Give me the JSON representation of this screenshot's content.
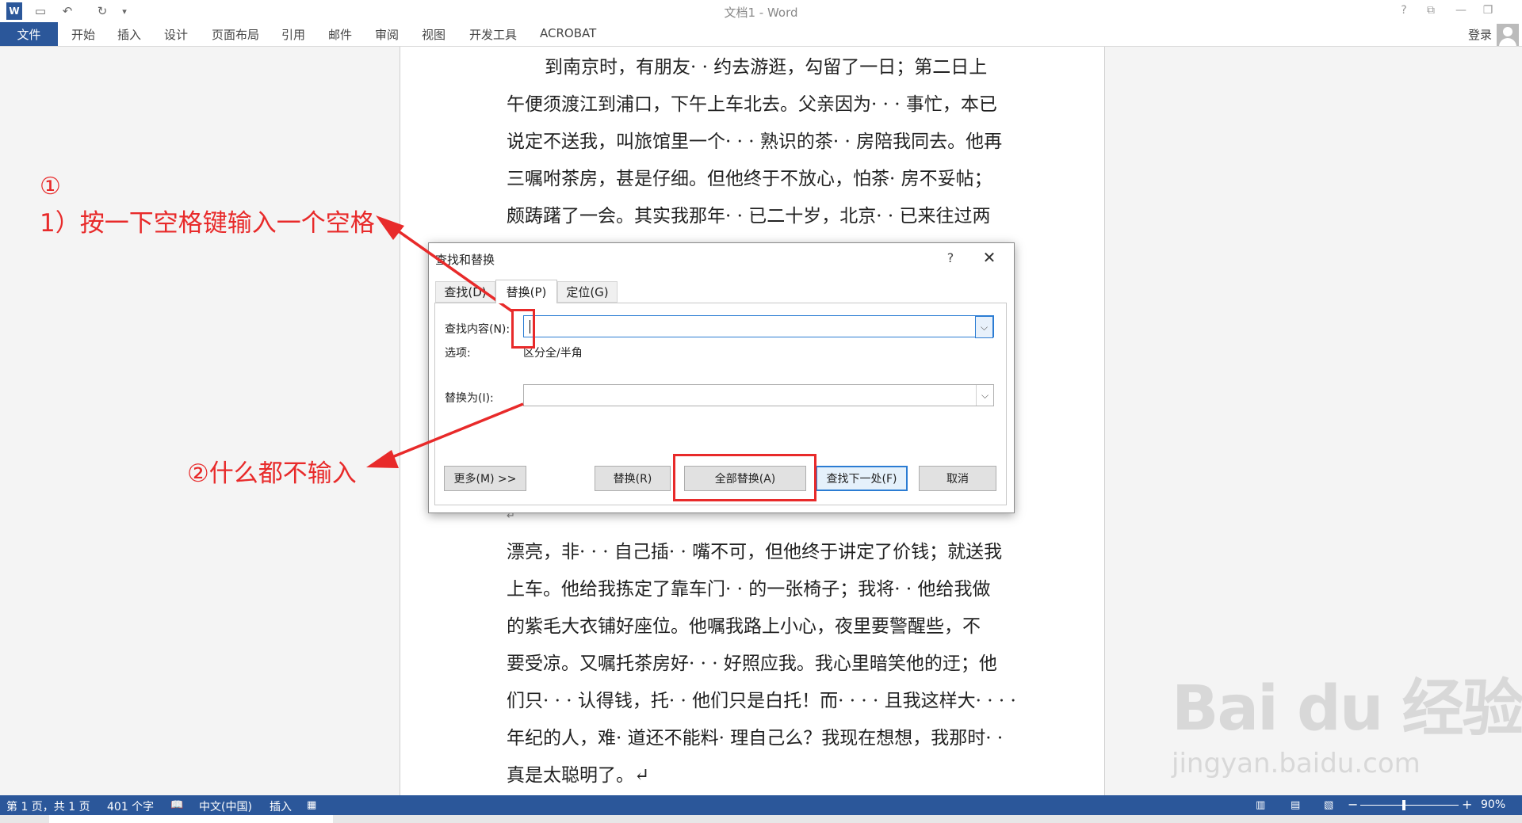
{
  "window": {
    "title": "文档1 - Word",
    "buttons": {
      "help": "?",
      "ribbon_display": "⧉",
      "minimize": "—",
      "restore": "❐"
    }
  },
  "quick_access": {
    "app_icon": "W",
    "save": "▭",
    "undo": "↶",
    "redo": "↻",
    "customize": "▾"
  },
  "ribbon": {
    "file_tab": "文件",
    "tabs": [
      "开始",
      "插入",
      "设计",
      "页面布局",
      "引用",
      "邮件",
      "审阅",
      "视图",
      "开发工具",
      "ACROBAT"
    ],
    "signin": "登录",
    "active_color": "#2b579a"
  },
  "document": {
    "lines_top": [
      "到南京时，有朋友· · 约去游逛，勾留了一日；第二日上",
      "午便须渡江到浦口，下午上车北去。父亲因为· · · 事忙，本已",
      "说定不送我，叫旅馆里一个· · · 熟识的茶· · 房陪我同去。他再",
      "三嘱咐茶房，甚是仔细。但他终于不放心，怕茶· 房不妥帖；",
      "颇踌躇了一会。其实我那年· · 已二十岁，北京· · 已来往过两"
    ],
    "paragraph_mark": "↵",
    "lines_bottom": [
      "漂亮，非· · · 自己插· · 嘴不可，但他终于讲定了价钱；就送我",
      "上车。他给我拣定了靠车门· · 的一张椅子；我将· · 他给我做",
      "的紫毛大衣铺好座位。他嘱我路上小心，夜里要警醒些，不",
      "要受凉。又嘱托茶房好· · · 好照应我。我心里暗笑他的迂；他",
      "们只· · · 认得钱，托· · 他们只是白托！而· · · · 且我这样大· · · ·",
      "年纪的人，难· 道还不能料· 理自己么？我现在想想，我那时· ·",
      "真是太聪明了。↵"
    ]
  },
  "annotations": {
    "step1_marker": "①",
    "step1_text": "1）按一下空格键输入一个空格",
    "step2_text": "②什么都不输入",
    "color": "#e82a2a"
  },
  "dialog": {
    "title": "查找和替换",
    "help": "?",
    "close": "✕",
    "tabs": [
      "查找(D)",
      "替换(P)",
      "定位(G)"
    ],
    "active_tab_index": 1,
    "find_label": "查找内容(N):",
    "find_value": "",
    "options_label": "选项:",
    "options_value": "区分全/半角",
    "replace_label": "替换为(I):",
    "replace_value": "",
    "dropdown_arrow": "⌵",
    "buttons": {
      "more": "更多(M) >>",
      "replace": "替换(R)",
      "replace_all": "全部替换(A)",
      "find_next": "查找下一处(F)",
      "cancel": "取消"
    }
  },
  "statusbar": {
    "page": "第 1 页，共 1 页",
    "words": "401 个字",
    "proofing_icon": "📖",
    "language": "中文(中国)",
    "mode": "插入",
    "macro_icon": "▦",
    "view_read": "▥",
    "view_print": "▤",
    "view_web": "▧",
    "zoom_minus": "−",
    "zoom_plus": "+",
    "zoom": "90%",
    "zoom_level_percent": 90
  },
  "watermark": {
    "main": "Bai du 经验",
    "sub": "jingyan.baidu.com"
  }
}
